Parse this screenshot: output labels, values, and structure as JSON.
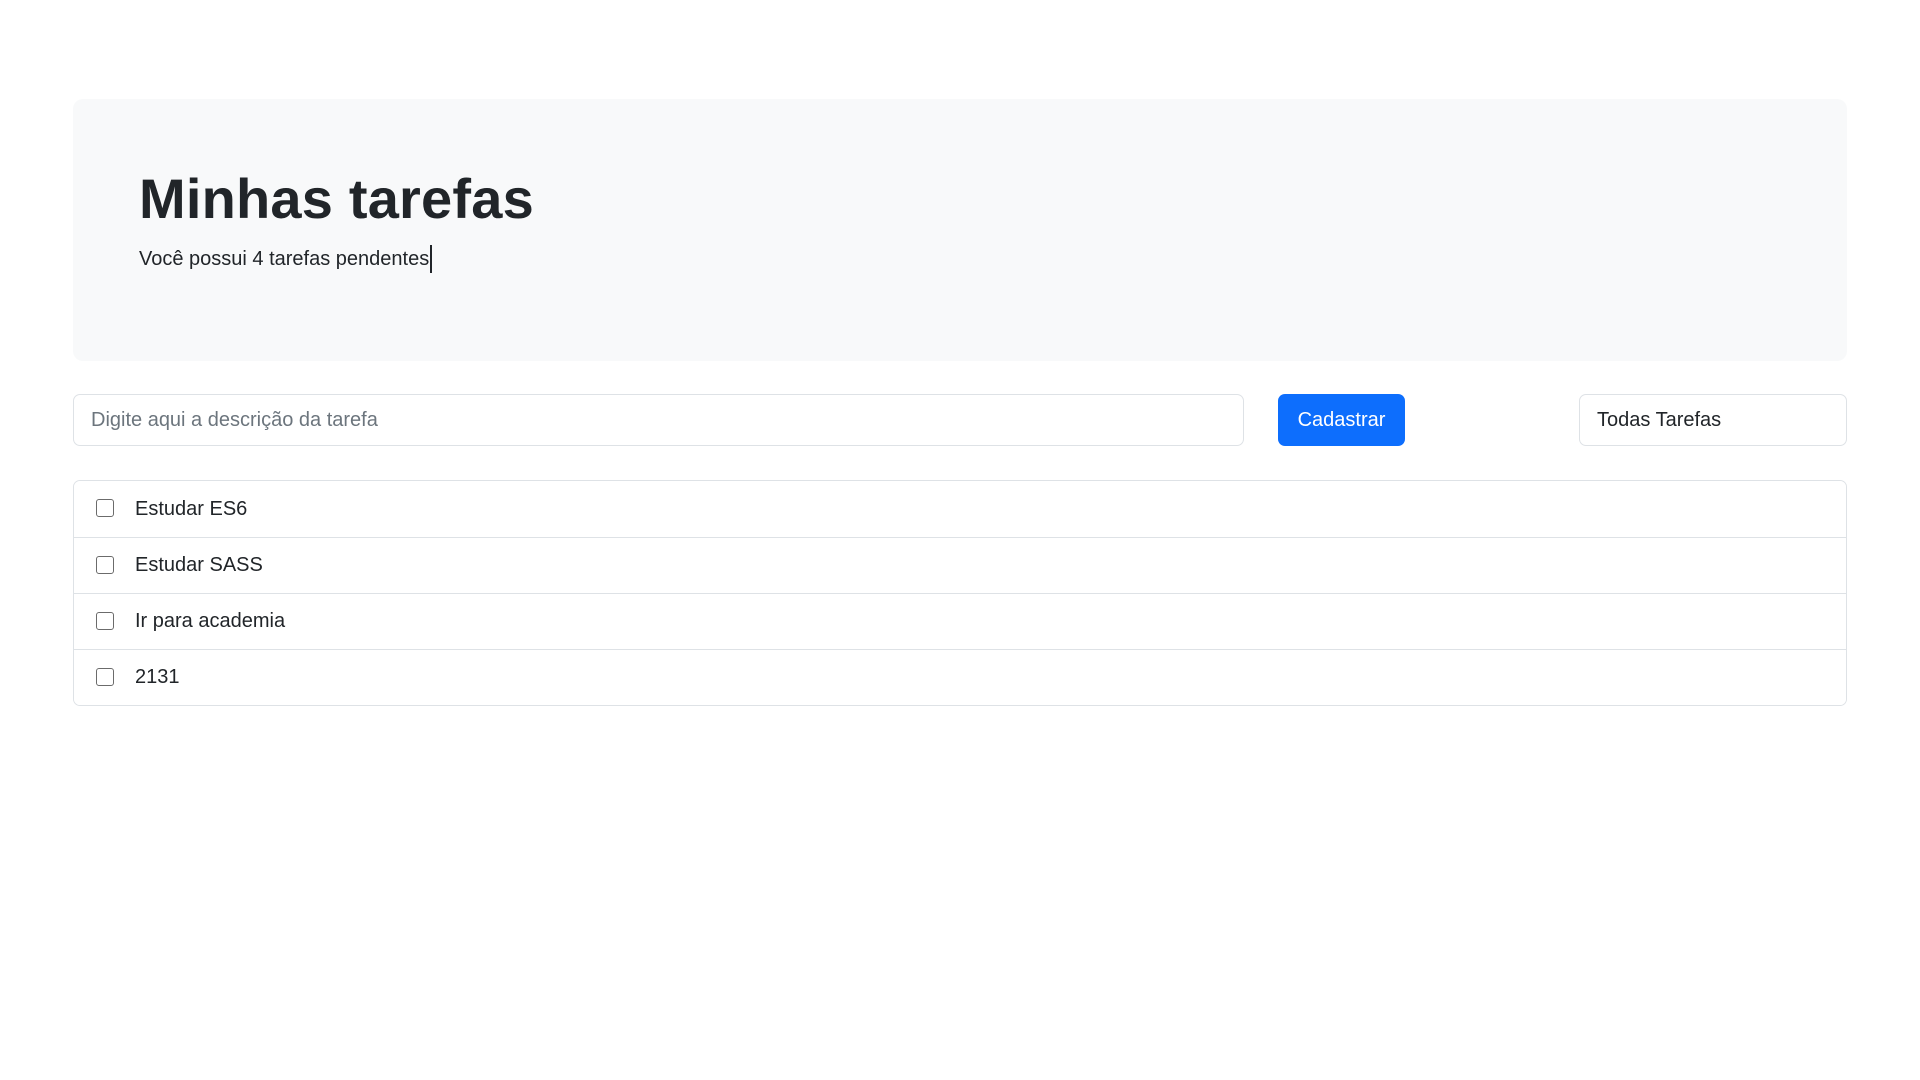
{
  "header": {
    "title": "Minhas tarefas",
    "subtitle": "Você possui 4 tarefas pendentes"
  },
  "form": {
    "input_placeholder": "Digite aqui a descrição da tarefa",
    "input_value": "",
    "add_button_label": "Cadastrar",
    "filter_selected": "Todas Tarefas"
  },
  "tasks": [
    {
      "label": "Estudar ES6",
      "checked": false
    },
    {
      "label": "Estudar SASS",
      "checked": false
    },
    {
      "label": "Ir para academia",
      "checked": false
    },
    {
      "label": "2131",
      "checked": false
    }
  ],
  "colors": {
    "accent": "#0d6efd",
    "panel_background": "#f8f9fa",
    "border": "#dee2e6",
    "text": "#212529",
    "placeholder": "#6c757d"
  }
}
